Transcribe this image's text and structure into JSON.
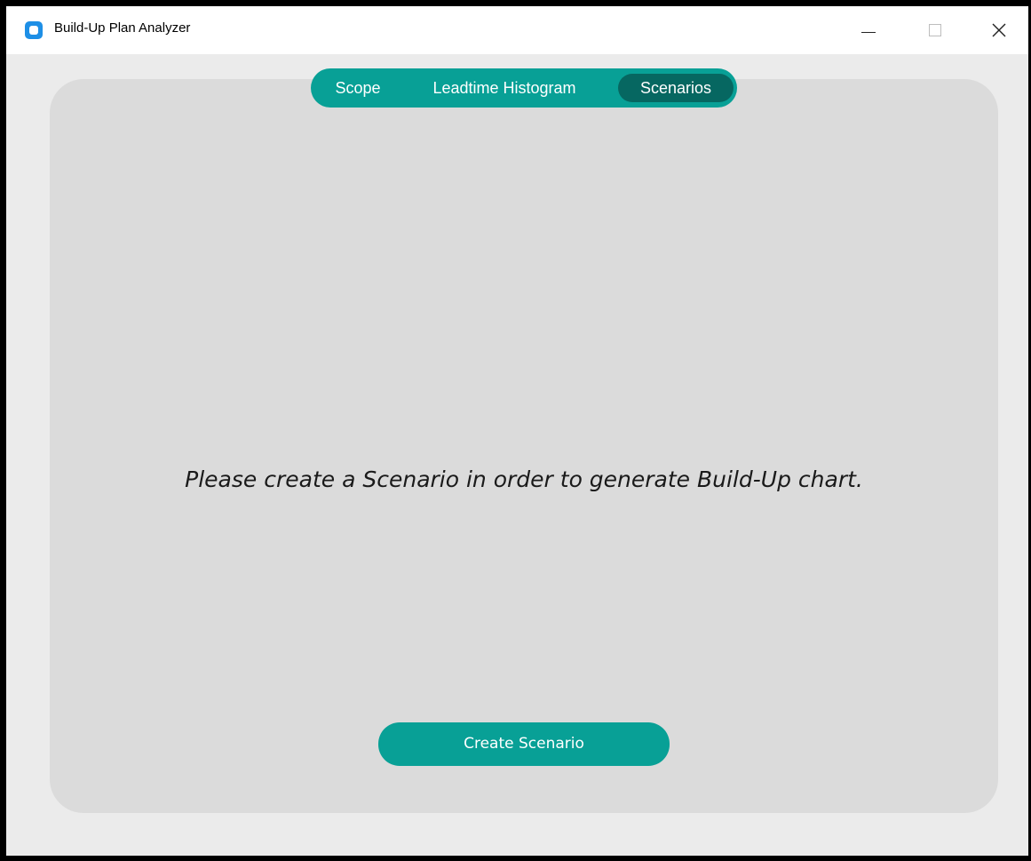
{
  "window": {
    "title": "Build-Up Plan Analyzer",
    "icon": "app-icon",
    "controls": {
      "minimize_icon": "minimize-icon",
      "maximize_icon": "maximize-icon",
      "close_icon": "close-icon"
    }
  },
  "tabs": [
    {
      "label": "Scope",
      "selected": false
    },
    {
      "label": "Leadtime Histogram",
      "selected": false
    },
    {
      "label": "Scenarios",
      "selected": true
    }
  ],
  "main": {
    "message": "Please create a Scenario in order to generate Build-Up chart.",
    "create_button_label": "Create Scenario"
  },
  "colors": {
    "accent": "#08a096",
    "accent_selected": "#066761",
    "panel": "#dbdbdb",
    "window_background": "#ebebeb"
  }
}
